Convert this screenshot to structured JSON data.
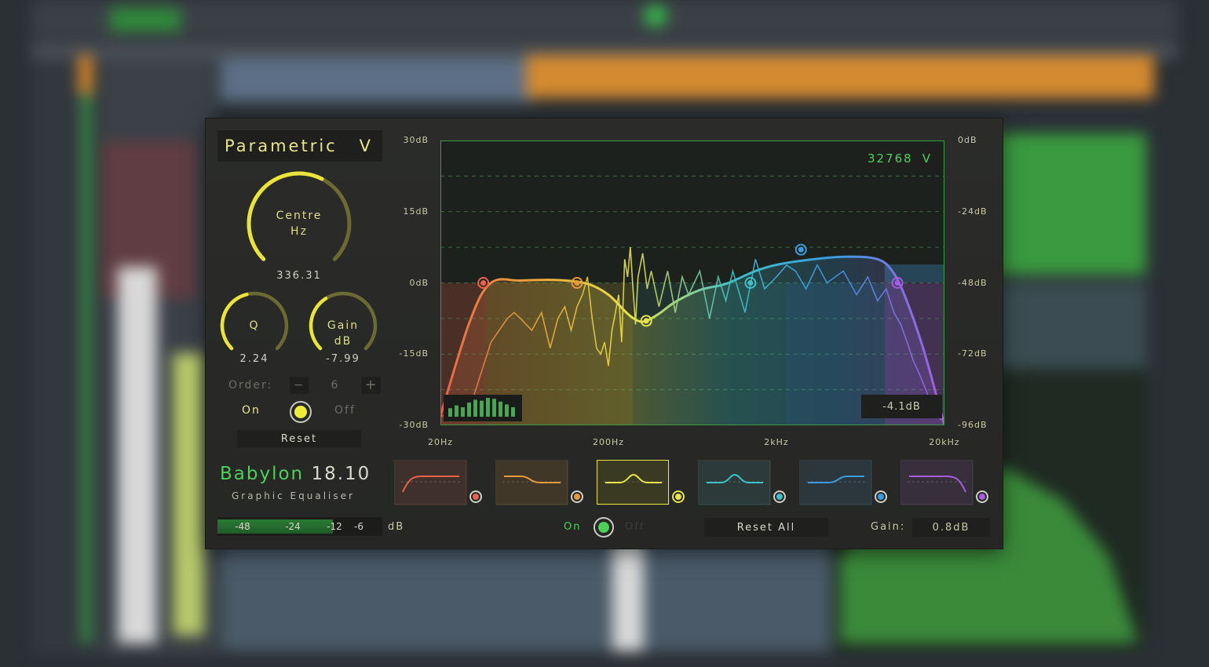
{
  "plugin": {
    "mode": {
      "label": "Parametric",
      "chevron": "V"
    },
    "knobs": {
      "centre": {
        "label_line1": "Centre",
        "label_line2": "Hz",
        "value": "336.31",
        "level": 0.6
      },
      "q": {
        "label": "Q",
        "value": "2.24",
        "level": 0.45
      },
      "gain": {
        "label_line1": "Gain",
        "label_line2": "dB",
        "value": "-7.99",
        "level": 0.38
      }
    },
    "order": {
      "label": "Order:",
      "value": "6",
      "minus": "−",
      "plus": "+"
    },
    "band_toggle": {
      "on_label": "On",
      "off_label": "Off",
      "state": "on"
    },
    "reset_label": "Reset",
    "brand": {
      "name": "Babylon",
      "version": "18.10",
      "subtitle": "Graphic Equaliser"
    },
    "meter": {
      "ticks": [
        "-48",
        "-24",
        "-12",
        "-6"
      ],
      "unit": "dB",
      "level": 0.7
    },
    "global_toggle": {
      "on_label": "On",
      "off_label": "Off",
      "state": "on"
    },
    "reset_all_label": "Reset All",
    "gain": {
      "label": "Gain:",
      "value": "0.8dB"
    },
    "fft": {
      "size": "32768",
      "chevron": "V"
    },
    "readout": "-4.1dB",
    "colors": {
      "accent": "#e8e34a",
      "green": "#4ccf5a",
      "band1": "#e8634a",
      "band2": "#e89a3a",
      "band3": "#e8e34a",
      "band4": "#3ec0c8",
      "band5": "#3a9be0",
      "band6": "#a85ce0"
    },
    "bands": [
      {
        "name": "low-cut",
        "color": "#e8634a",
        "selected": false
      },
      {
        "name": "low-shelf",
        "color": "#e89a3a",
        "selected": false
      },
      {
        "name": "bell",
        "color": "#e8e34a",
        "selected": true
      },
      {
        "name": "bell",
        "color": "#3ec0c8",
        "selected": false
      },
      {
        "name": "high-shelf",
        "color": "#3a9be0",
        "selected": false
      },
      {
        "name": "high-cut",
        "color": "#a85ce0",
        "selected": false
      }
    ],
    "chart_data": {
      "type": "line",
      "left_axis_labels": [
        "30dB",
        "15dB",
        "0dB",
        "-15dB",
        "-30dB"
      ],
      "right_axis_labels": [
        "0dB",
        "-24dB",
        "-48dB",
        "-72dB",
        "-96dB"
      ],
      "x_labels": [
        "20Hz",
        "200Hz",
        "2kHz",
        "20kHz"
      ],
      "x_scale": "log",
      "xlim": [
        20,
        20000
      ],
      "ylim_left": [
        -30,
        30
      ],
      "ylim_right": [
        -96,
        0
      ],
      "grid": true,
      "eq_curve": [
        [
          20,
          -28
        ],
        [
          30,
          -8
        ],
        [
          40,
          0
        ],
        [
          60,
          0.5
        ],
        [
          100,
          0.6
        ],
        [
          150,
          -0.2
        ],
        [
          200,
          -2.5
        ],
        [
          260,
          -6.5
        ],
        [
          300,
          -8
        ],
        [
          336,
          -8
        ],
        [
          400,
          -6.5
        ],
        [
          500,
          -4
        ],
        [
          700,
          -1.5
        ],
        [
          1000,
          -0.2
        ],
        [
          1500,
          2.5
        ],
        [
          2000,
          3.8
        ],
        [
          3000,
          4.8
        ],
        [
          5000,
          5.5
        ],
        [
          8000,
          5
        ],
        [
          10000,
          2
        ],
        [
          12000,
          -4
        ],
        [
          15000,
          -14
        ],
        [
          18000,
          -24
        ],
        [
          20000,
          -30
        ]
      ],
      "nodes": [
        {
          "freq": 36,
          "gain": 0,
          "color": "#e8634a"
        },
        {
          "freq": 130,
          "gain": 0,
          "color": "#e89a3a"
        },
        {
          "freq": 336,
          "gain": -8,
          "color": "#e8e34a"
        },
        {
          "freq": 1400,
          "gain": 0,
          "color": "#3ec0c8"
        },
        {
          "freq": 2800,
          "gain": 7,
          "color": "#3a9be0"
        },
        {
          "freq": 10500,
          "gain": 0,
          "color": "#a85ce0"
        }
      ],
      "spectrum": [
        [
          20,
          -93
        ],
        [
          25,
          -92
        ],
        [
          30,
          -90
        ],
        [
          40,
          -68
        ],
        [
          50,
          -60
        ],
        [
          55,
          -58
        ],
        [
          60,
          -60
        ],
        [
          70,
          -64
        ],
        [
          80,
          -58
        ],
        [
          90,
          -70
        ],
        [
          100,
          -60
        ],
        [
          110,
          -56
        ],
        [
          120,
          -64
        ],
        [
          130,
          -56
        ],
        [
          140,
          -52
        ],
        [
          150,
          -46
        ],
        [
          160,
          -60
        ],
        [
          170,
          -70
        ],
        [
          180,
          -72
        ],
        [
          190,
          -68
        ],
        [
          200,
          -76
        ],
        [
          210,
          -64
        ],
        [
          220,
          -58
        ],
        [
          230,
          -52
        ],
        [
          240,
          -68
        ],
        [
          250,
          -40
        ],
        [
          260,
          -46
        ],
        [
          270,
          -36
        ],
        [
          280,
          -50
        ],
        [
          290,
          -62
        ],
        [
          300,
          -46
        ],
        [
          320,
          -38
        ],
        [
          340,
          -50
        ],
        [
          360,
          -44
        ],
        [
          400,
          -56
        ],
        [
          450,
          -44
        ],
        [
          500,
          -58
        ],
        [
          550,
          -46
        ],
        [
          600,
          -52
        ],
        [
          700,
          -44
        ],
        [
          800,
          -60
        ],
        [
          900,
          -46
        ],
        [
          1000,
          -54
        ],
        [
          1100,
          -44
        ],
        [
          1300,
          -58
        ],
        [
          1500,
          -40
        ],
        [
          1700,
          -50
        ],
        [
          2000,
          -46
        ],
        [
          2300,
          -42
        ],
        [
          2600,
          -44
        ],
        [
          3000,
          -50
        ],
        [
          3500,
          -42
        ],
        [
          4000,
          -48
        ],
        [
          5000,
          -44
        ],
        [
          6000,
          -52
        ],
        [
          7000,
          -46
        ],
        [
          8000,
          -54
        ],
        [
          9000,
          -50
        ],
        [
          10000,
          -58
        ],
        [
          11000,
          -62
        ],
        [
          12000,
          -68
        ],
        [
          13000,
          -74
        ],
        [
          14000,
          -78
        ],
        [
          15000,
          -82
        ],
        [
          16000,
          -86
        ],
        [
          17000,
          -90
        ],
        [
          18000,
          -92
        ],
        [
          19000,
          -94
        ],
        [
          20000,
          -94
        ]
      ],
      "mini_spectrum": [
        0.45,
        0.6,
        0.5,
        0.75,
        0.9,
        0.85,
        1.0,
        0.95,
        0.8,
        0.65,
        0.5
      ]
    }
  }
}
